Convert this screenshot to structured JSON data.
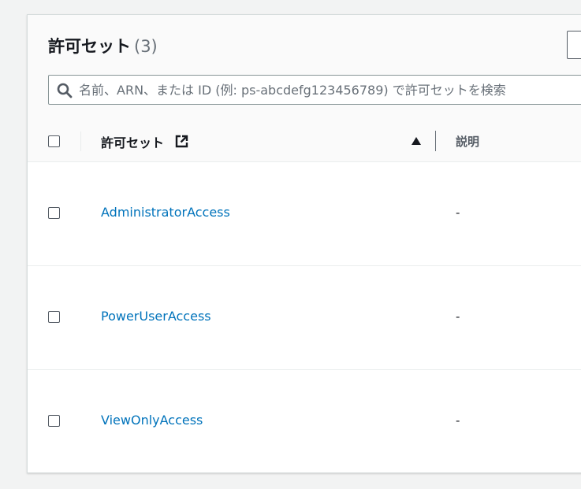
{
  "panel": {
    "title": "許可セット",
    "count": "(3)"
  },
  "search": {
    "placeholder": "名前、ARN、または ID (例: ps-abcdefg123456789) で許可セットを検索"
  },
  "table": {
    "columns": [
      {
        "label": "許可セット",
        "icon": "external-link-icon",
        "sort": "ascending"
      },
      {
        "label": "説明"
      }
    ],
    "rows": [
      {
        "name": "AdministratorAccess",
        "description": "-"
      },
      {
        "name": "PowerUserAccess",
        "description": "-"
      },
      {
        "name": "ViewOnlyAccess",
        "description": "-"
      }
    ]
  },
  "colors": {
    "link": "#0073bb",
    "text": "#16191f",
    "muted": "#687078",
    "border": "#eaeded",
    "background": "#f2f3f3"
  }
}
